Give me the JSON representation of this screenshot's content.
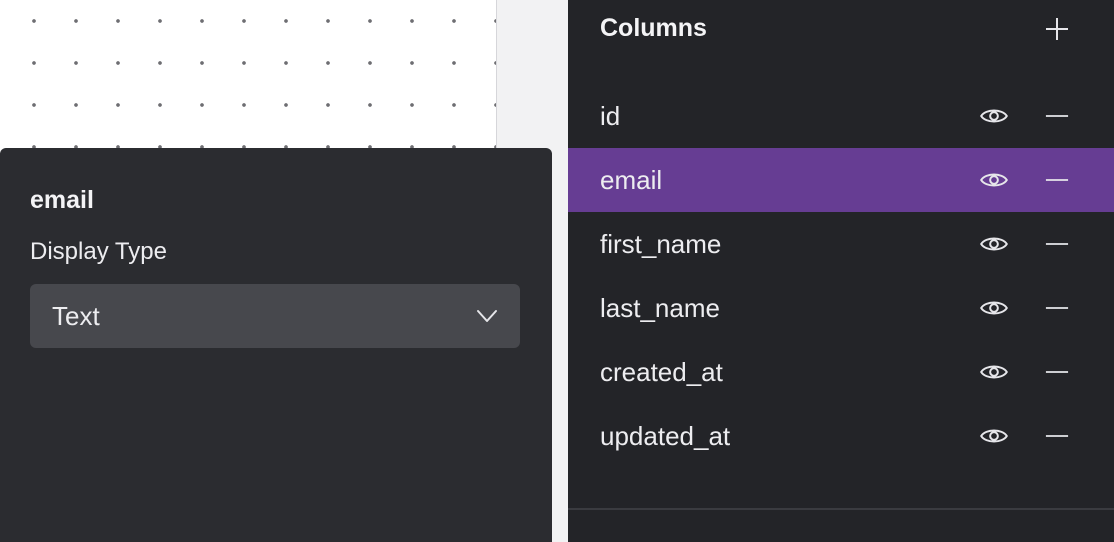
{
  "popover": {
    "heading": "email",
    "display_type_label": "Display Type",
    "display_type_value": "Text"
  },
  "sidebar": {
    "title": "Columns",
    "columns": [
      {
        "name": "id",
        "selected": false
      },
      {
        "name": "email",
        "selected": true
      },
      {
        "name": "first_name",
        "selected": false
      },
      {
        "name": "last_name",
        "selected": false
      },
      {
        "name": "created_at",
        "selected": false
      },
      {
        "name": "updated_at",
        "selected": false
      }
    ]
  },
  "icons": {
    "add": "plus-icon",
    "visibility": "eye-icon",
    "remove": "minus-icon",
    "dropdown": "chevron-down-icon"
  },
  "colors": {
    "sidebar_bg": "#232428",
    "popover_bg": "#2b2c30",
    "selected_row": "#663d93",
    "select_bg": "#47484d"
  }
}
